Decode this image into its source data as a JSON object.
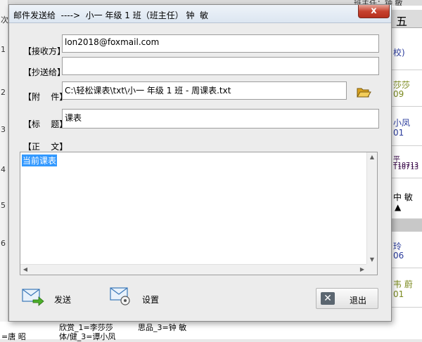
{
  "background": {
    "top_text": "班主任：钟 敏",
    "right_header": "五",
    "left_rows": [
      "次",
      "1",
      "2",
      "3",
      "4",
      "5",
      "6"
    ],
    "right_cells": [
      {
        "name": "校)",
        "code": ""
      },
      {
        "name": "莎莎",
        "code": "09"
      },
      {
        "name": "小凤",
        "code": "01"
      },
      {
        "name": "平 T10713",
        "code": "T10713"
      },
      {
        "name": "中  敏",
        "code": ""
      },
      {
        "name": "  玲",
        "code": "06"
      },
      {
        "name": "韦  蔚",
        "code": "01"
      }
    ],
    "bottom_cells": [
      "欣赏_1=李莎莎",
      "思品_3=钟  敏",
      "=唐  昭",
      "体/健_3=谭小凤"
    ]
  },
  "dialog": {
    "title": "邮件发送给  ---->  小一 年级 1 班（班主任） 钟  敏",
    "close_label": "x",
    "to_label": "【接收方】",
    "to_value": "lon2018@foxmail.com",
    "cc_label": "【抄送给】",
    "cc_value": "",
    "attach_label": "【附    件】",
    "attach_value": "C:\\轻松课表\\txt\\小一 年级 1 班 - 周课表.txt",
    "subject_label": "【标    题】",
    "subject_value": "课表",
    "body_label": "【正    文】",
    "body_value": "当前课表",
    "send_label": "发送",
    "settings_label": "设置",
    "exit_label": "退出"
  },
  "icons": {
    "folder": "folder-open-icon",
    "send": "mail-send-icon",
    "settings": "mail-settings-icon",
    "exit": "close-icon"
  }
}
